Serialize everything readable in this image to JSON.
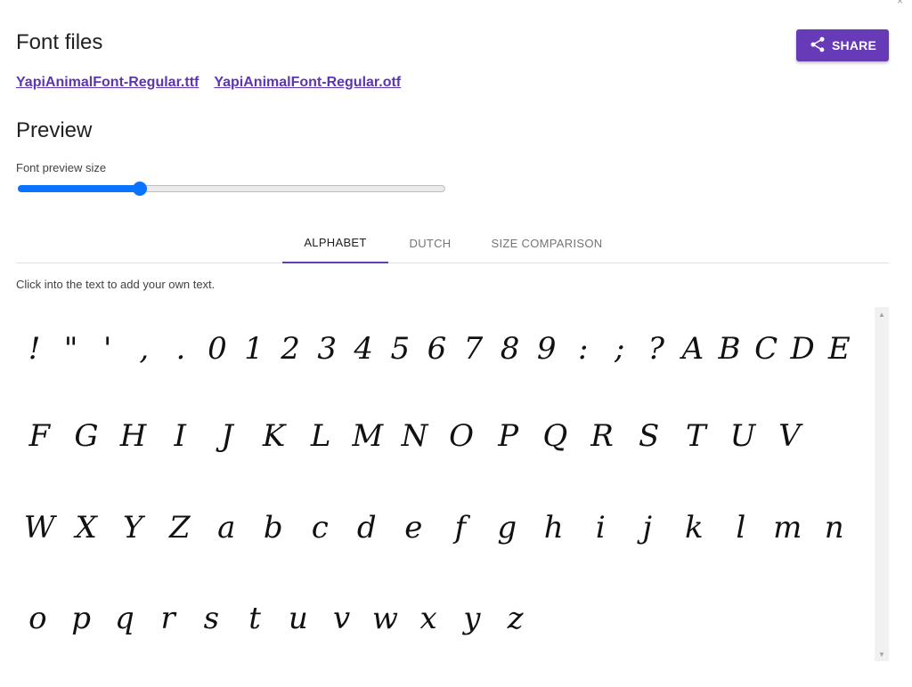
{
  "header": {
    "title": "Font files",
    "share_label": "SHARE"
  },
  "files": [
    {
      "label": "YapiAnimalFont-Regular.ttf"
    },
    {
      "label": "YapiAnimalFont-Regular.otf"
    }
  ],
  "preview": {
    "title": "Preview",
    "size_label": "Font preview size",
    "size_slider_fraction": 0.285
  },
  "tabs": [
    {
      "label": "ALPHABET",
      "active": true
    },
    {
      "label": "DUTCH",
      "active": false
    },
    {
      "label": "SIZE COMPARISON",
      "active": false
    }
  ],
  "hint": "Click into the text to add your own text.",
  "glyph_rows": [
    [
      "!",
      "\"",
      "'",
      ",",
      ".",
      "0",
      "1",
      "2",
      "3",
      "4",
      "5",
      "6",
      "7",
      "8",
      "9",
      ":",
      ";",
      "?",
      "A",
      "B",
      "C",
      "D",
      "E"
    ],
    [
      "F",
      "G",
      "H",
      "I",
      "J",
      "K",
      "L",
      "M",
      "N",
      "O",
      "P",
      "Q",
      "R",
      "S",
      "T",
      "U",
      "V"
    ],
    [
      "W",
      "X",
      "Y",
      "Z",
      "a",
      "b",
      "c",
      "d",
      "e",
      "f",
      "g",
      "h",
      "i",
      "j",
      "k",
      "l",
      "m",
      "n"
    ],
    [
      "o",
      "p",
      "q",
      "r",
      "s",
      "t",
      "u",
      "v",
      "w",
      "x",
      "y",
      "z"
    ]
  ],
  "colors": {
    "accent": "#673ab7",
    "link": "#5e35b1",
    "slider": "#0a73ff"
  },
  "icons": {
    "share": "share-icon",
    "scroll_up": "scroll-up-arrow-icon",
    "scroll_down": "scroll-down-arrow-icon"
  }
}
